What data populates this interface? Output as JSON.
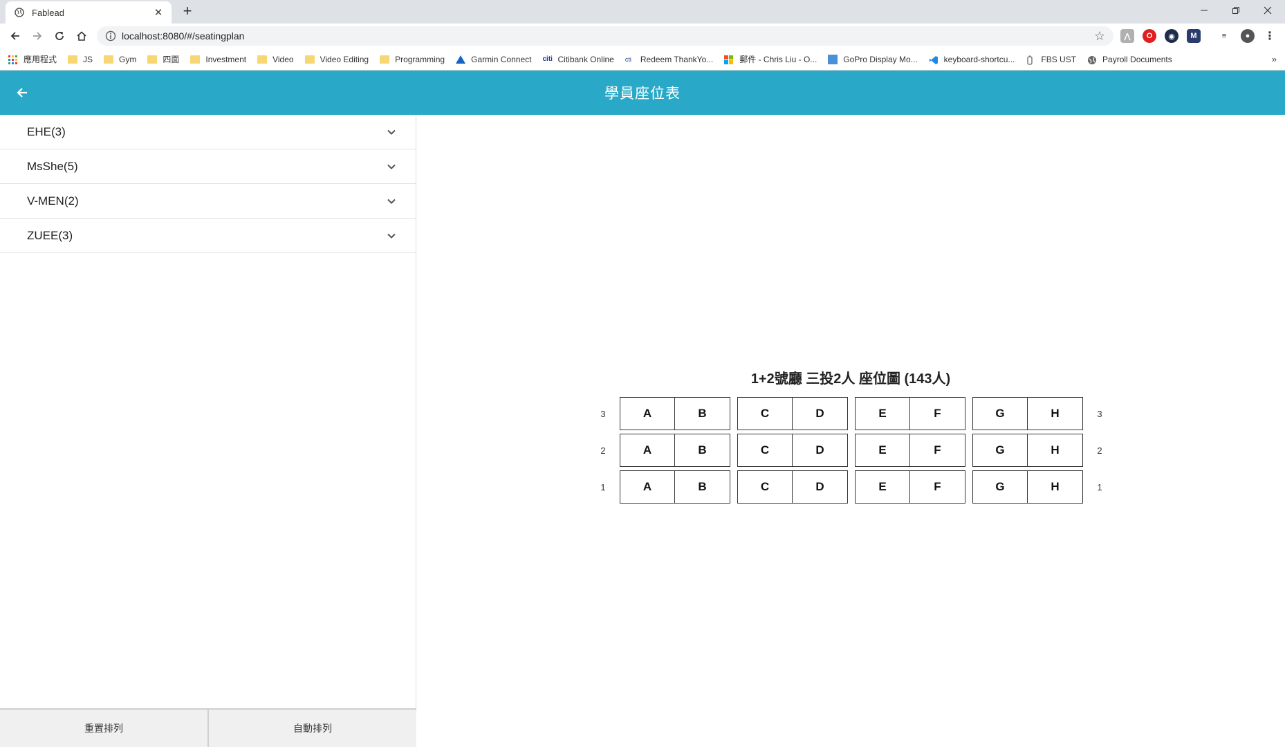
{
  "browser": {
    "tab_title": "Fablead",
    "url": "localhost:8080/#/seatingplan",
    "bookmarks": [
      {
        "label": "應用程式",
        "icon": "apps-grid-icon"
      },
      {
        "label": "JS",
        "icon": "folder-icon"
      },
      {
        "label": "Gym",
        "icon": "folder-icon"
      },
      {
        "label": "四面",
        "icon": "folder-icon"
      },
      {
        "label": "Investment",
        "icon": "folder-icon"
      },
      {
        "label": "Video",
        "icon": "folder-icon"
      },
      {
        "label": "Video Editing",
        "icon": "folder-icon"
      },
      {
        "label": "Programming",
        "icon": "folder-icon"
      },
      {
        "label": "Garmin Connect",
        "icon": "garmin-icon"
      },
      {
        "label": "Citibank Online",
        "icon": "citi-icon"
      },
      {
        "label": "Redeem ThankYo...",
        "icon": "citi-icon"
      },
      {
        "label": "郵件 - Chris Liu - O...",
        "icon": "microsoft-icon"
      },
      {
        "label": "GoPro Display Mo...",
        "icon": "gopro-icon"
      },
      {
        "label": "keyboard-shortcu...",
        "icon": "vscode-icon"
      },
      {
        "label": "FBS UST",
        "icon": "fbs-icon"
      },
      {
        "label": "Payroll Documents",
        "icon": "globe-icon"
      }
    ]
  },
  "app": {
    "title": "學員座位表",
    "groups": [
      {
        "label": "EHE(3)"
      },
      {
        "label": "MsShe(5)"
      },
      {
        "label": "V-MEN(2)"
      },
      {
        "label": "ZUEE(3)"
      }
    ],
    "buttons": {
      "reset": "重置排列",
      "auto": "自動排列"
    },
    "seating_title": "1+2號廳 三投2人 座位圖 (143人)",
    "rows": [
      {
        "number": "3",
        "blocks": [
          [
            "A",
            "B"
          ],
          [
            "C",
            "D"
          ],
          [
            "E",
            "F"
          ],
          [
            "G",
            "H"
          ]
        ]
      },
      {
        "number": "2",
        "blocks": [
          [
            "A",
            "B"
          ],
          [
            "C",
            "D"
          ],
          [
            "E",
            "F"
          ],
          [
            "G",
            "H"
          ]
        ]
      },
      {
        "number": "1",
        "blocks": [
          [
            "A",
            "B"
          ],
          [
            "C",
            "D"
          ],
          [
            "E",
            "F"
          ],
          [
            "G",
            "H"
          ]
        ]
      }
    ]
  },
  "colors": {
    "appbar": "#29a9c7",
    "folder": "#f7d774"
  }
}
